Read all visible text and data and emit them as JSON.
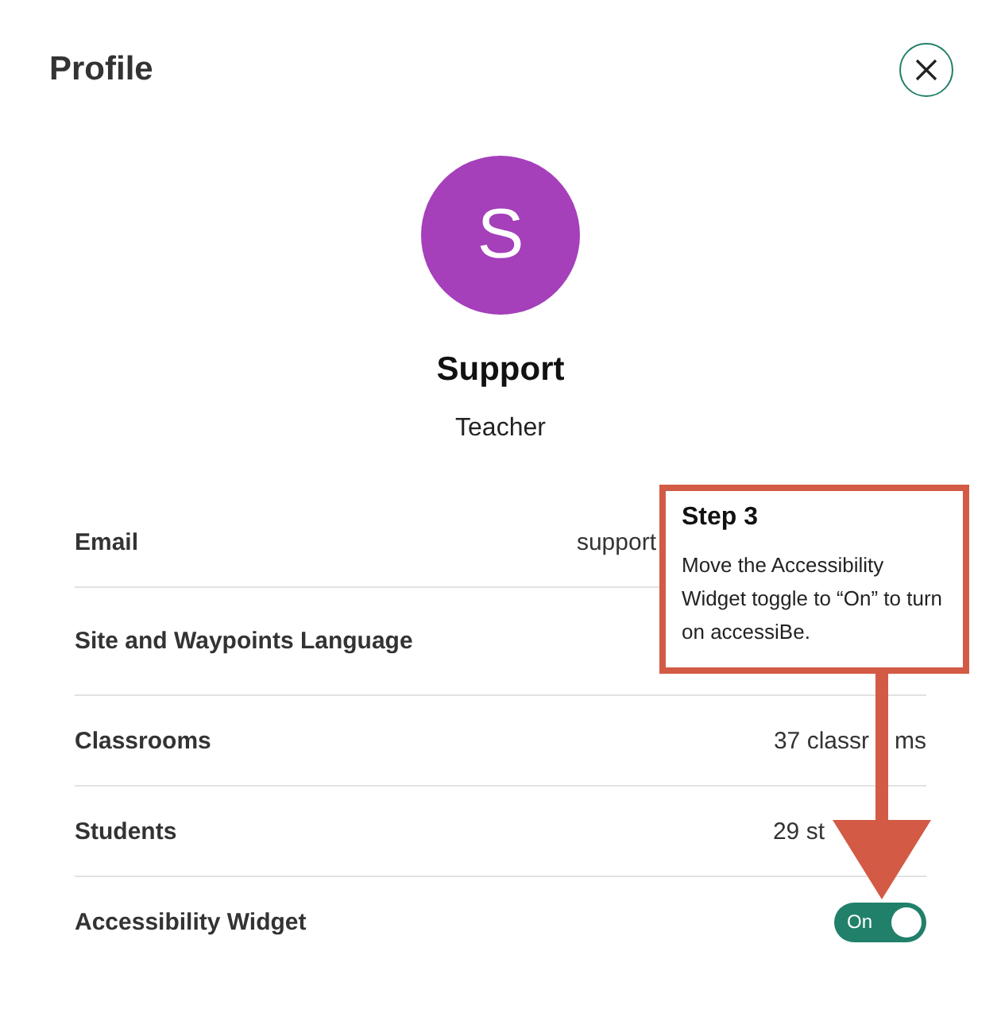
{
  "title": "Profile",
  "user": {
    "initial": "S",
    "name": "Support",
    "role": "Teacher"
  },
  "rows": [
    {
      "kind": "text",
      "label": "Email",
      "value": "support"
    },
    {
      "kind": "text",
      "label": "Site and Waypoints Language"
    },
    {
      "kind": "text",
      "label": "Classrooms",
      "value": "37 classr",
      "tail": "ms"
    },
    {
      "kind": "text",
      "label": "Students",
      "value": "29 st"
    },
    {
      "kind": "toggle",
      "label": "Accessibility Widget",
      "on": true,
      "state_label": "On"
    }
  ],
  "callout": {
    "title": "Step 3",
    "text": "Move the Accessibility Widget toggle to “On” to turn on accessiBe."
  }
}
